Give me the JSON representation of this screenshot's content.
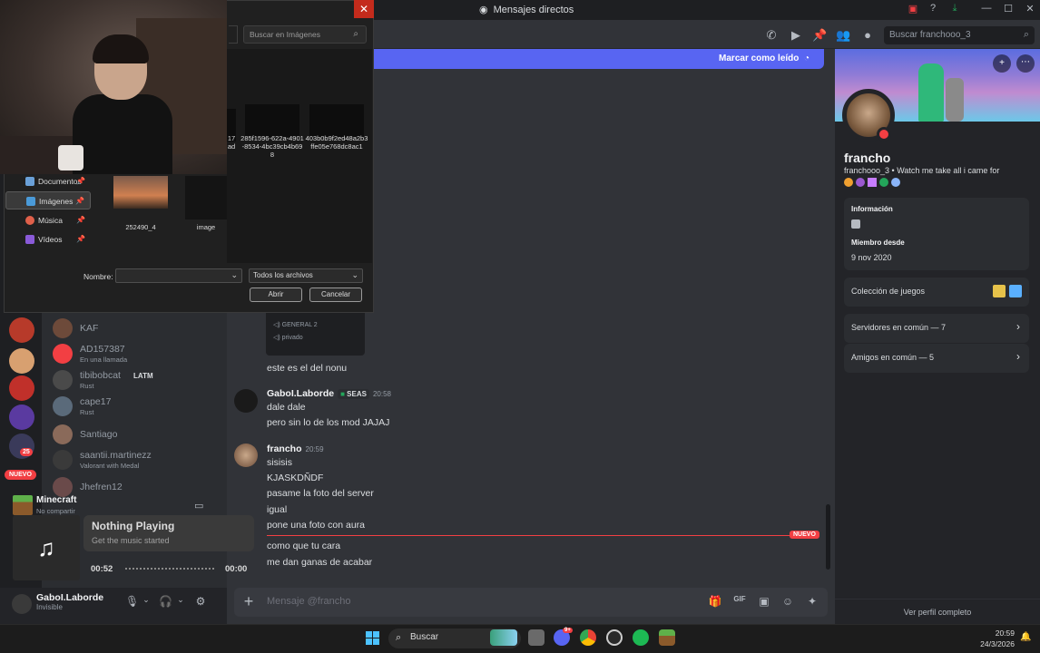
{
  "window": {
    "title": "Mensajes directos",
    "buttons": [
      "—",
      "☐",
      "✕"
    ]
  },
  "topbar": {
    "search_placeholder": "Buscar franchooo_3"
  },
  "banner": {
    "mark_read": "Marcar como leído"
  },
  "embed": {
    "lines": [
      "GENERAL 2",
      "privado"
    ]
  },
  "messages": [
    {
      "text": "este es el del nonu"
    },
    {
      "author": "GaboI.Laborde",
      "tag": "SEAS",
      "time": "20:58",
      "lines": [
        "dale dale",
        "pero sin lo de los mod JAJAJ"
      ]
    },
    {
      "author": "francho",
      "time": "20:59",
      "lines": [
        "sisisis",
        "KJASKDÑDF",
        "pasame la foto del server",
        "igual",
        "pone una foto con aura"
      ]
    },
    {
      "lines": [
        "como que tu cara",
        "me dan ganas de acabar"
      ]
    }
  ],
  "new_divider": "NUEVO",
  "composer": {
    "placeholder": "Mensaje @francho"
  },
  "profile": {
    "name": "francho",
    "username": "franchooo_3",
    "custom_status": "Watch me take all i came for",
    "info_label": "Información",
    "member_since_label": "Miembro desde",
    "member_since": "9 nov 2020",
    "games_label": "Colección de juegos",
    "servers_label": "Servidores en común — 7",
    "friends_label": "Amigos en común — 5",
    "full_profile": "Ver perfil completo"
  },
  "dms": [
    {
      "name": "KAF",
      "sub": "",
      "color": "#6d4a3a"
    },
    {
      "name": "AD157387",
      "sub": "En una llamada",
      "color": "#f23f43"
    },
    {
      "name": "tibibobcat",
      "sub": "Rust",
      "tag": "LATM",
      "color": "#4a4a4a"
    },
    {
      "name": "cape17",
      "sub": "Rust",
      "color": "#5a6a7a"
    },
    {
      "name": "Santiago",
      "sub": "",
      "color": "#8a6a5a"
    },
    {
      "name": "saantii.martinezz",
      "sub": "Valorant with Medal",
      "color": "#3a3a3a"
    },
    {
      "name": "Jhefren12",
      "sub": "",
      "color": "#6a4a4a"
    }
  ],
  "rail": {
    "badge_25": "25",
    "nuevo": "NUEVO"
  },
  "activity": {
    "game": "Minecraft",
    "game_sub": "No compartir",
    "now_playing": "Nothing Playing",
    "now_playing_sub": "Get the music started",
    "time_start": "00:52",
    "time_end": "00:00",
    "progress": 0
  },
  "user": {
    "name": "GaboI.Laborde",
    "status": "Invisible"
  },
  "dialog": {
    "search_placeholder": "Buscar en Imágenes",
    "nav": [
      {
        "label": "Documentos",
        "color": "#6aa0d8"
      },
      {
        "label": "Imágenes",
        "color": "#4a9ad8"
      },
      {
        "label": "Música",
        "color": "#e0604a"
      },
      {
        "label": "Vídeos",
        "color": "#8a5ad8"
      }
    ],
    "files": [
      {
        "name": "17 ad"
      },
      {
        "name": "285f1596-622a-4901-8534-4bc39cb4b698"
      },
      {
        "name": "403b0b9f2ed48a2b3ffe05e768dc8ac1"
      },
      {
        "name": "252490_4"
      },
      {
        "name": "image"
      }
    ],
    "name_label": "Nombre:",
    "filter": "Todos los archivos",
    "open": "Abrir",
    "cancel": "Cancelar"
  },
  "taskbar": {
    "search": "Buscar",
    "time": "20:59",
    "date": "24/3/2026",
    "discord_badge": "9+"
  },
  "colors": {
    "accent": "#5865f2",
    "danger": "#f23f43",
    "bg": "#313338"
  }
}
